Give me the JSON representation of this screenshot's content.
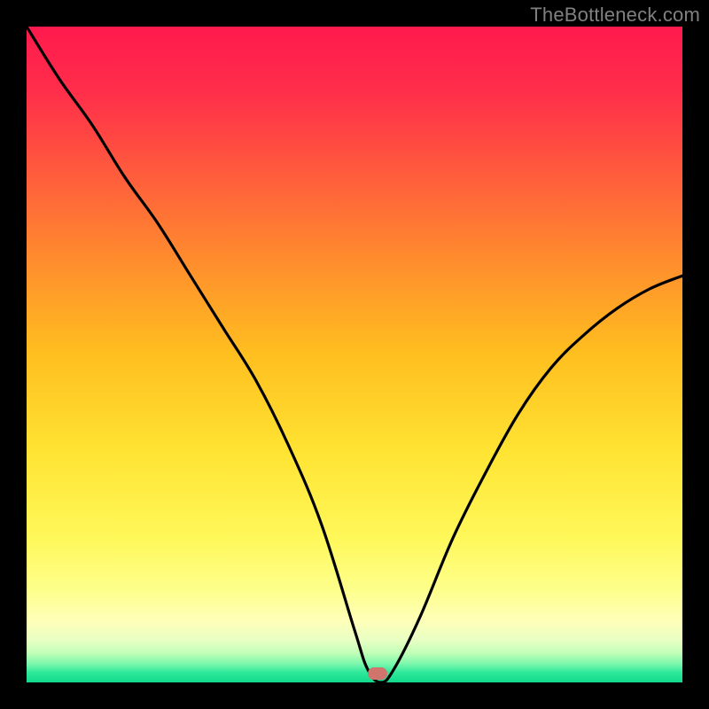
{
  "watermark": "TheBottleneck.com",
  "marker": {
    "color": "#d1746e",
    "x_frac": 0.535,
    "y_frac": 0.986
  },
  "gradient_stops": [
    {
      "offset": 0.0,
      "color": "#ff1a4d"
    },
    {
      "offset": 0.1,
      "color": "#ff2e4a"
    },
    {
      "offset": 0.22,
      "color": "#ff5a3d"
    },
    {
      "offset": 0.35,
      "color": "#ff8a2e"
    },
    {
      "offset": 0.5,
      "color": "#ffbf1f"
    },
    {
      "offset": 0.65,
      "color": "#ffe433"
    },
    {
      "offset": 0.78,
      "color": "#fff85a"
    },
    {
      "offset": 0.86,
      "color": "#fdff8c"
    },
    {
      "offset": 0.905,
      "color": "#ffffb8"
    },
    {
      "offset": 0.935,
      "color": "#e9ffc3"
    },
    {
      "offset": 0.955,
      "color": "#c2ffb8"
    },
    {
      "offset": 0.972,
      "color": "#79f7ac"
    },
    {
      "offset": 0.985,
      "color": "#2de89a"
    },
    {
      "offset": 1.0,
      "color": "#12d98c"
    }
  ],
  "chart_data": {
    "type": "line",
    "title": "",
    "xlabel": "",
    "ylabel": "",
    "xlim": [
      0,
      100
    ],
    "ylim": [
      0,
      100
    ],
    "grid": false,
    "annotations": [
      {
        "text": "TheBottleneck.com",
        "role": "watermark"
      }
    ],
    "series": [
      {
        "name": "bottleneck-curve",
        "x": [
          0,
          5,
          10,
          15,
          20,
          25,
          30,
          35,
          40,
          45,
          50,
          52,
          54,
          56,
          60,
          65,
          70,
          75,
          80,
          85,
          90,
          95,
          100
        ],
        "y": [
          100,
          92,
          85,
          77,
          70,
          62,
          54,
          46,
          36,
          24,
          8,
          2,
          0,
          2,
          10,
          22,
          32,
          41,
          48,
          53,
          57,
          60,
          62
        ]
      }
    ],
    "background_gradient": {
      "direction": "vertical",
      "meaning": "y=0 green (good) to y=100 red (bad)"
    },
    "marker_point": {
      "x": 53.5,
      "y": 1.5,
      "color": "#d1746e"
    }
  }
}
